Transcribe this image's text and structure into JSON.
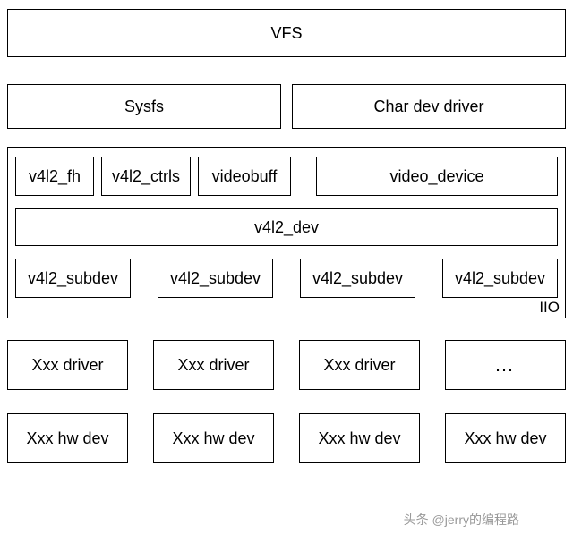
{
  "layers": {
    "vfs": "VFS",
    "sysfs": "Sysfs",
    "chardev": "Char dev driver"
  },
  "iio": {
    "label": "IIO",
    "row1": {
      "fh": "v4l2_fh",
      "ctrls": "v4l2_ctrls",
      "videobuff": "videobuff",
      "video_device": "video_device"
    },
    "v4l2_dev": "v4l2_dev",
    "subdevs": [
      "v4l2_subdev",
      "v4l2_subdev",
      "v4l2_subdev",
      "v4l2_subdev"
    ]
  },
  "drivers": [
    "Xxx driver",
    "Xxx driver",
    "Xxx driver",
    "…"
  ],
  "hw": [
    "Xxx hw dev",
    "Xxx hw dev",
    "Xxx hw dev",
    "Xxx hw dev"
  ],
  "watermark": "头条 @jerry的编程路"
}
